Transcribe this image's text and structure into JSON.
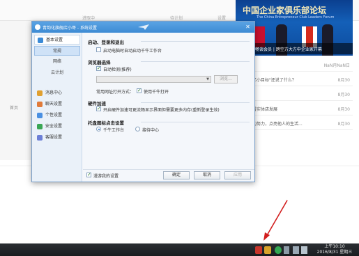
{
  "background": {
    "columns": [
      "进取中",
      "待计划",
      "设置"
    ],
    "left_label": "首页",
    "news_banner": "中国企业家俱乐部论坛",
    "news_banner_sub": "The China Entrepreneur Club Leaders Forum",
    "news_caption": "中外大佬畅谈会员 | 跨空方大方中企业家开幕",
    "news_rows": [
      {
        "title": "",
        "date": "NaN月NaN日"
      },
      {
        "title": "了一个亿小目标\"还说了什么？",
        "date": "8月30"
      },
      {
        "title": "",
        "date": "8月30"
      },
      {
        "title": "角度下看实体店发展",
        "date": "8月30"
      },
      {
        "title": "用自己的努力，点亮他人的生活...",
        "date": "8月30"
      }
    ]
  },
  "window": {
    "title": "青韵化旗舰店小哥 - 系统设置",
    "close_icon": "close-icon"
  },
  "sidebar": {
    "items": [
      {
        "label": "基本设置",
        "icon_color": "#3a8ad6",
        "type": "head"
      },
      {
        "label": "常规",
        "type": "sub",
        "active": true
      },
      {
        "label": "网络",
        "type": "sub"
      },
      {
        "label": "云计划",
        "type": "sub"
      },
      {
        "label": "消息中心",
        "icon_color": "#e0a030",
        "type": "item"
      },
      {
        "label": "聊天设置",
        "icon_color": "#e07b3a",
        "type": "item"
      },
      {
        "label": "个性设置",
        "icon_color": "#4a90e2",
        "type": "item"
      },
      {
        "label": "安全设置",
        "icon_color": "#3aa655",
        "type": "item"
      },
      {
        "label": "客服设置",
        "icon_color": "#6c7fd6",
        "type": "item"
      }
    ]
  },
  "content": {
    "section_startup": "启动、登录和退出",
    "opt_autostart": "启动电脑时自动启动千牛工作台",
    "section_browser": "浏览器选择",
    "opt_autodetect": "自动检测(推荐)",
    "browse_label": "浏览...",
    "common_open_label": "常用网址打开方式：",
    "opt_use_qianniu": "使用千牛打开",
    "section_hw": "硬件加速",
    "opt_hw": "开启硬件加速可更流畅显示界面但需要更多内存(重新登录生效)",
    "section_tray": "托盘图标点击设置",
    "radio_workbench": "千牛工作台",
    "radio_service": "接待中心",
    "roam_label": "漫游我的设置",
    "ok": "确定",
    "cancel": "取消",
    "apply": "应用"
  },
  "taskbar": {
    "time": "上午10:10",
    "date": "2016/8/31 星期三"
  }
}
